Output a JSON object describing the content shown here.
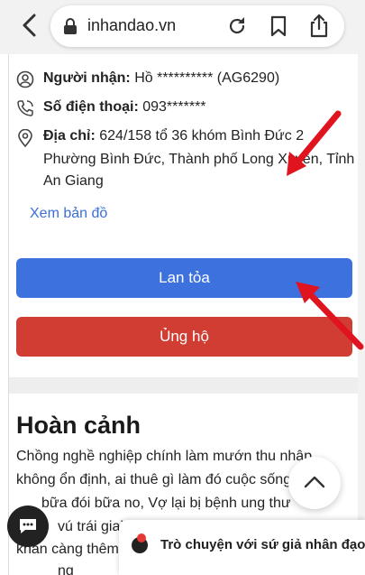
{
  "browser": {
    "url": "inhandao.vn",
    "icons": [
      "back-icon",
      "lock-icon",
      "reload-icon",
      "bookmark-icon",
      "share-icon"
    ]
  },
  "recipient": {
    "name_label": "Người nhận:",
    "name_value": "Hồ ********** (AG6290)",
    "phone_label": "Số điện thoại:",
    "phone_value": "093*******",
    "address_label": "Địa chỉ:",
    "address_line1": "624/158 tổ 36 khóm Bình Đức 2",
    "address_line2": "Phường Bình Đức, Thành phố Long Xuyên, Tỉnh",
    "address_line3": "An Giang",
    "map_link": "Xem bản đồ"
  },
  "actions": {
    "spread_label": "Lan tỏa",
    "support_label": "Ủng hộ",
    "spread_color": "#3d72de",
    "support_color": "#d13d32"
  },
  "story": {
    "heading": "Hoàn cảnh",
    "lines": [
      "Chồng nghề nghiệp chính làm mướn thu nhập",
      "không ổn định, ai thuê gì làm đó cuộc sống",
      "bữa đói bữa no, Vợ lại bị bệnh ung thư",
      "vú trái giai",
      "khăn càng thêm",
      "ng"
    ]
  },
  "chat": {
    "bar_text": "Trò chuyện với sứ giả nhân đạo"
  },
  "annotation_color": "#e0141e"
}
